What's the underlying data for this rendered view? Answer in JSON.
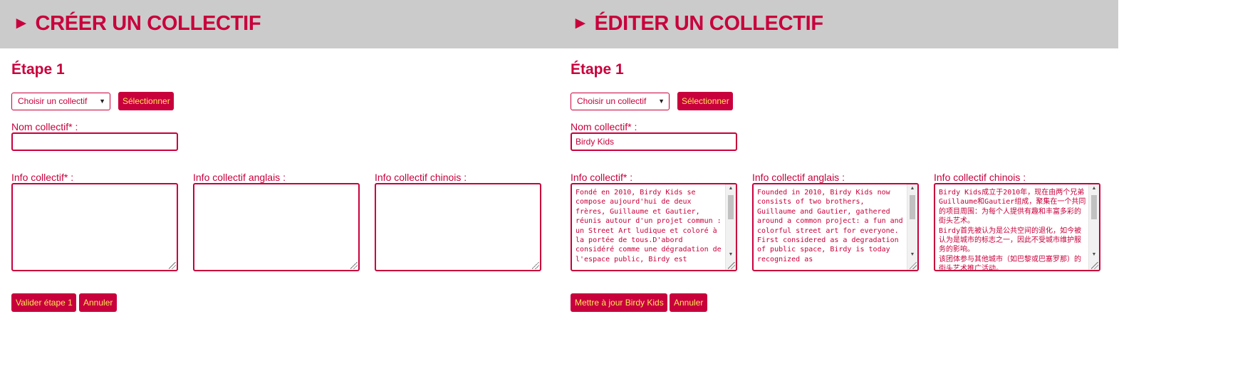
{
  "create": {
    "title": "CRÉER UN COLLECTIF",
    "step": "Étape 1",
    "select_value": "Choisir un collectif",
    "select_button": "Sélectionner",
    "name_label": "Nom collectif* :",
    "name_value": "",
    "info_label": "Info collectif* :",
    "info_en_label": "Info collectif anglais :",
    "info_zh_label": "Info collectif chinois :",
    "info_text": "",
    "info_en_text": "",
    "info_zh_text": "",
    "submit_button": "Valider étape 1",
    "cancel_button": "Annuler"
  },
  "edit": {
    "title": "ÉDITER UN COLLECTIF",
    "step": "Étape 1",
    "select_value": "Choisir un collectif",
    "select_button": "Sélectionner",
    "name_label": "Nom collectif* :",
    "name_value": "Birdy Kids",
    "info_label": "Info collectif* :",
    "info_en_label": "Info collectif anglais :",
    "info_zh_label": "Info collectif chinois :",
    "info_text": "Fondé en 2010, Birdy Kids se compose aujourd'hui de deux frères, Guillaume et Gautier, réunis autour d'un projet commun : un Street Art ludique et coloré à la portée de tous.D'abord considéré comme une dégradation de l'espace public, Birdy est",
    "info_en_text": "Founded in 2010, Birdy Kids now consists of two brothers, Guillaume and Gautier, gathered around a common project: a fun and colorful street art for everyone.\nFirst considered as a degradation of public space, Birdy is today recognized as",
    "info_zh_text": "Birdy Kids成立于2010年，现在由两个兄弟Guillaume和Gautier组成，聚集在一个共同的项目周围：为每个人提供有趣和丰富多彩的街头艺术。\nBirdy首先被认为是公共空间的退化，如今被认为是城市的标志之一，因此不受城市维护服务的影响。\n该团体参与其他城市（如巴黎或巴塞罗那）的街头艺术推广活动。",
    "submit_button": "Mettre à jour Birdy Kids",
    "cancel_button": "Annuler"
  },
  "colors": {
    "accent": "#c8003c",
    "button_text": "#ffe55c",
    "header_bg": "#cbcbcb"
  }
}
